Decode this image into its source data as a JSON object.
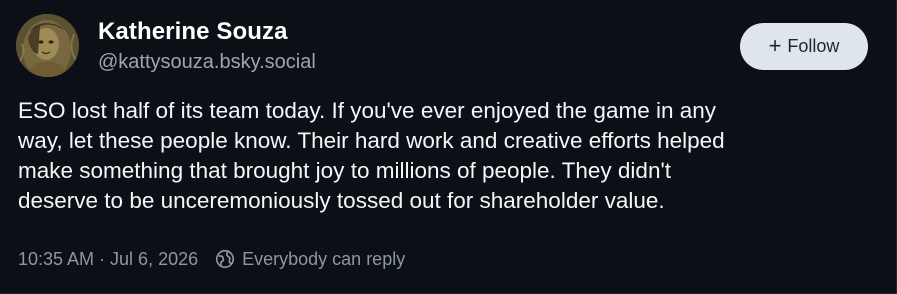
{
  "author": {
    "display_name": "Katherine Souza",
    "handle": "@kattysouza.bsky.social"
  },
  "follow_button": {
    "icon": "plus-icon",
    "label": "Follow"
  },
  "post": {
    "lines": [
      "ESO lost half of its team today. If you've ever enjoyed the game in any",
      "way, let these people know. Their hard work and creative efforts helped",
      "make something that brought joy to millions of people. They didn't",
      "deserve to be unceremoniously tossed out for shareholder value."
    ],
    "timestamp": "10:35 AM · Jul 6, 2026",
    "reply_setting": "Everybody can reply",
    "reply_setting_icon": "globe-icon"
  },
  "colors": {
    "background": "#0c1016",
    "text": "#f4f6f8",
    "muted": "#8b97a4",
    "follow_button_bg": "#dfe5ec"
  }
}
